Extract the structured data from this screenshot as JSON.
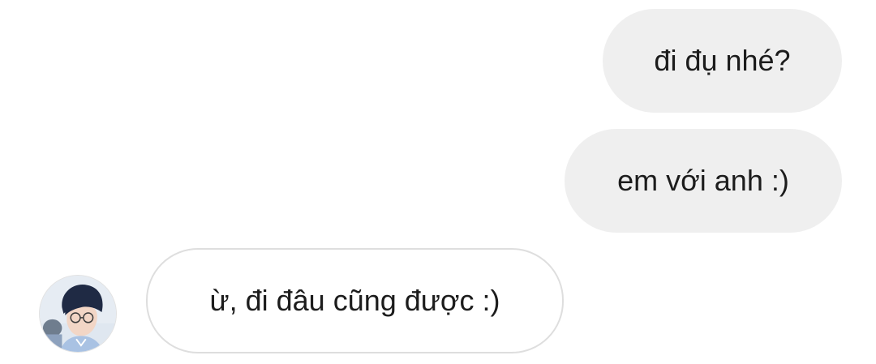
{
  "conversation": {
    "messages": [
      {
        "direction": "outgoing",
        "text": "đi đụ nhé?"
      },
      {
        "direction": "outgoing",
        "text": "em với anh :)"
      },
      {
        "direction": "incoming",
        "text": "ừ, đi đâu cũng được :)"
      }
    ],
    "contact": {
      "avatar_icon": "profile-photo-avatar"
    }
  },
  "colors": {
    "outgoing_bubble": "#efefef",
    "incoming_bubble": "#ffffff",
    "incoming_border": "#dedede",
    "text": "#1c1c1c",
    "background": "#ffffff"
  }
}
